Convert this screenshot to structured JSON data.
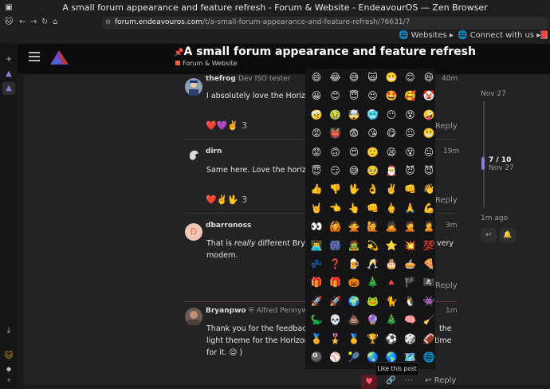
{
  "window": {
    "title": "A small forum appearance and feature refresh - Forum & Website - EndeavourOS — Zen Browser"
  },
  "browser": {
    "url_domain": "forum.endeavouros.com",
    "url_path": "/t/a-small-forum-appearance-and-feature-refresh/76631/7",
    "bookmarks": [
      "Websites",
      "Connect with us"
    ]
  },
  "topic": {
    "title": "A small forum appearance and feature refresh",
    "category": "Forum & Website"
  },
  "posts": [
    {
      "username": "thefrog",
      "user_title": "Dev ISO tester",
      "time": "40m",
      "text": "I absolutely love the Horizon t",
      "reactions": "❤️💜✌️",
      "reaction_count": "3",
      "reply": "Reply"
    },
    {
      "username": "dirn",
      "user_title": "",
      "time": "19m",
      "text": "Same here. Love the horizon",
      "reactions": "❤️✌️🖖",
      "reaction_count": "3",
      "reply": "Reply"
    },
    {
      "username": "dbarronoss",
      "user_title": "",
      "time": "3m",
      "avatar_letter": "D",
      "text_1_a": "That is ",
      "text_1_em": "really",
      "text_1_b": " different Bryan, I",
      "text_1_tail": "very",
      "text_2": "modern.",
      "reply": "Reply"
    },
    {
      "username": "Bryanpwo",
      "user_title": "Alfred Pennyworth",
      "time": "1m",
      "text_1": "Thank you for the feedback! I",
      "text_1_tail": "the",
      "text_2": "light theme for the Horizon the",
      "text_2_tail": "time",
      "text_3": "for it. 😉 )"
    }
  ],
  "timeline": {
    "start": "Nov 27",
    "position": "7 / 10",
    "position_date": "Nov 27",
    "end": "1m ago",
    "progress": 0.7
  },
  "emoji_rows": [
    [
      "😄",
      "😂",
      "😅",
      "🙀",
      "😬",
      "😊",
      "😆"
    ],
    [
      "😀",
      "😊",
      "😇",
      "😌",
      "🤩",
      "🥰",
      "🤡"
    ],
    [
      "🤕",
      "🤢",
      "🤯",
      "🥶",
      "😶",
      "😵",
      "🤪"
    ],
    [
      "😡",
      "👹",
      "😨",
      "😘",
      "😋",
      "😐",
      "😬"
    ],
    [
      "😟",
      "🙃",
      "😍",
      "🙂",
      "😫",
      "😵",
      "😐"
    ],
    [
      "😇",
      "😏",
      "😅",
      "🥺",
      "🎅",
      "😈",
      "😈"
    ],
    [
      "👍",
      "👎",
      "🖖",
      "👌",
      "✌️",
      "👊",
      "👋"
    ],
    [
      "🤘",
      "👈",
      "👆",
      "👊",
      "🖕",
      "🙏",
      "💪"
    ],
    [
      "👀",
      "🙆",
      "🙅",
      "🙋",
      "🙇",
      "🤦",
      "🙎"
    ],
    [
      "👨‍💻",
      "🎆",
      "🧟",
      "💫",
      "⭐",
      "💥",
      "💯"
    ],
    [
      "💤",
      "❓",
      "🍺",
      "🥂",
      "🎂",
      "🥧",
      "🍕"
    ],
    [
      "🎁",
      "🎁",
      "🎃",
      "🎄",
      "🔺",
      "🏴",
      "🏴‍☠️"
    ],
    [
      "🚀",
      "🚀",
      "🌍",
      "🐸",
      "🐈",
      "🐧",
      "👾"
    ],
    [
      "🦕",
      "💀",
      "💩",
      "🔮",
      "🎄",
      "🧠",
      "🧹"
    ],
    [
      "🏅",
      "🎖️",
      "🥇",
      "🏆",
      "⚽",
      "🎲",
      "🏈"
    ],
    [
      "🎱",
      "⚾",
      "🎾",
      "🌏",
      "🌎",
      "🗺️",
      "🌐"
    ]
  ],
  "tooltip": "Like this post",
  "bottom": {
    "reply": "Reply"
  },
  "colors": {
    "accent": "#8a7bd6",
    "category": "#e8663d",
    "like": "#ff5f6f"
  }
}
